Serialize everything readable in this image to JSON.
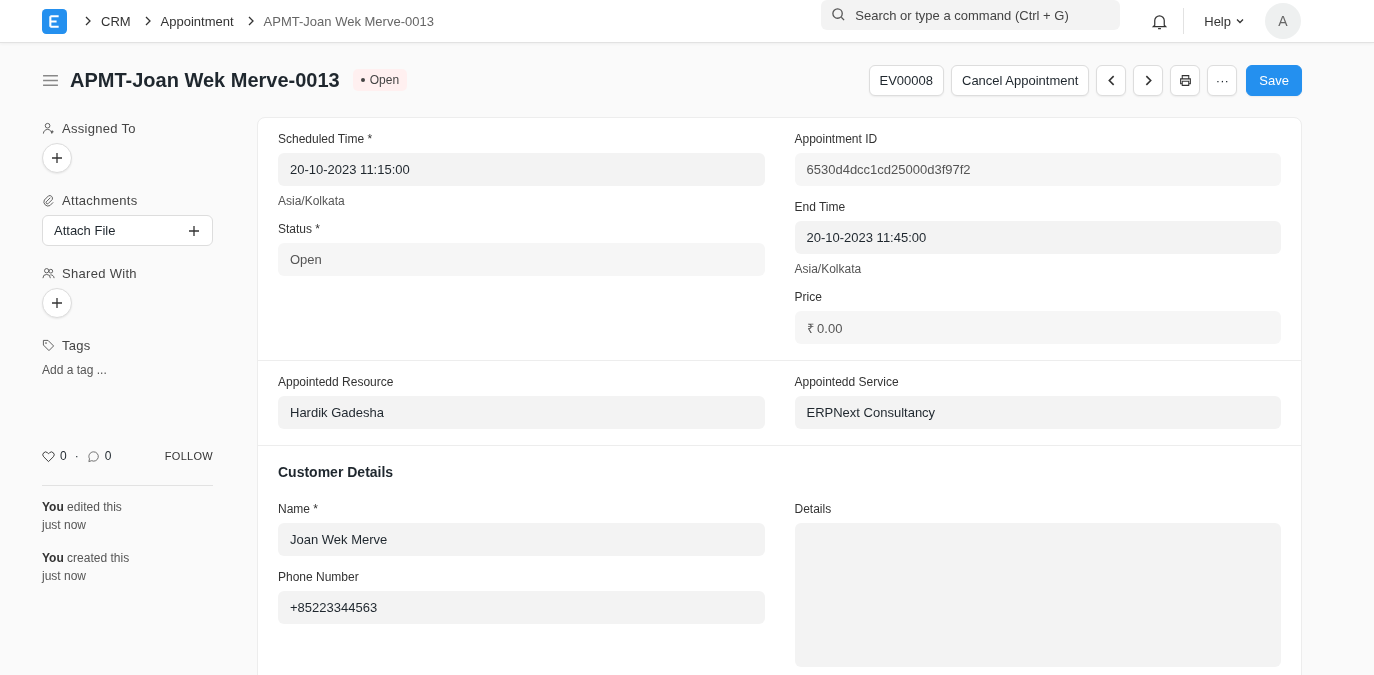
{
  "navbar": {
    "breadcrumbs": [
      "CRM",
      "Appointment",
      "APMT-Joan Wek Merve-0013"
    ],
    "search": {
      "placeholder": "Search or type a command (Ctrl + G)"
    },
    "help": "Help",
    "avatar": "A"
  },
  "header": {
    "title": "APMT-Joan Wek Merve-0013",
    "status": "Open",
    "buttons": [
      {
        "kind": "text",
        "label": "EV00008"
      },
      {
        "kind": "text",
        "label": "Cancel Appointment"
      },
      {
        "kind": "prev"
      },
      {
        "kind": "next"
      },
      {
        "kind": "print"
      },
      {
        "kind": "more",
        "label": "···"
      },
      {
        "kind": "primary",
        "label": "Save"
      }
    ]
  },
  "sidebar": {
    "assigned_to": "Assigned To",
    "attachments": "Attachments",
    "attach_file": "Attach File",
    "shared_with": "Shared With",
    "tags": "Tags",
    "add_tag": "Add a tag ...",
    "likes": "0",
    "separator": "·",
    "comments": "0",
    "follow": "FOLLOW",
    "activity": [
      {
        "who": "You",
        "action": "edited this",
        "when": "just now"
      },
      {
        "who": "You",
        "action": "created this",
        "when": "just now"
      }
    ]
  },
  "sections": [
    {
      "columns": [
        [
          {
            "label": "Scheduled Time *",
            "value": "20-10-2023 11:15:00",
            "readonly": false,
            "hint": "Asia/Kolkata"
          },
          {
            "label": "Status *",
            "value": "Open",
            "readonly": true
          }
        ],
        [
          {
            "label": "Appointment ID",
            "value": "6530d4dcc1cd25000d3f97f2",
            "readonly": true
          },
          {
            "label": "End Time",
            "value": "20-10-2023 11:45:00",
            "readonly": false,
            "hint": "Asia/Kolkata"
          },
          {
            "label": "Price",
            "value": "₹ 0.00",
            "readonly": true
          }
        ]
      ]
    },
    {
      "columns": [
        [
          {
            "label": "Appointedd Resource",
            "value": "Hardik Gadesha",
            "readonly": false
          }
        ],
        [
          {
            "label": "Appointedd Service",
            "value": "ERPNext Consultancy",
            "readonly": false
          }
        ]
      ]
    },
    {
      "title": "Customer Details",
      "columns": [
        [
          {
            "label": "Name *",
            "value": "Joan Wek Merve",
            "readonly": false
          },
          {
            "label": "Phone Number",
            "value": "+85223344563",
            "readonly": false
          }
        ],
        [
          {
            "label": "Details",
            "kind": "textarea",
            "readonly": false
          }
        ]
      ]
    }
  ]
}
